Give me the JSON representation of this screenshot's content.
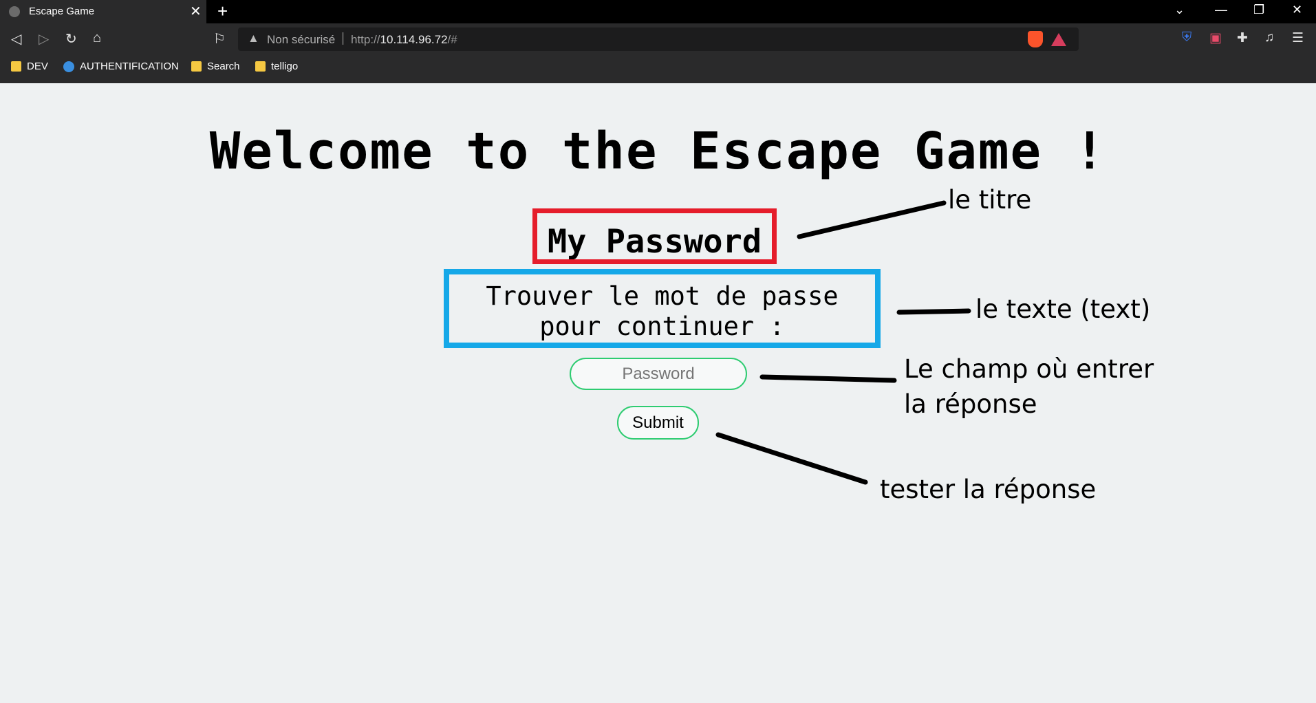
{
  "browser": {
    "tab_title": "Escape Game",
    "new_tab": "+",
    "url_warning": "Non sécurisé",
    "url_prefix": "http://",
    "url_host": "10.114.96.72",
    "url_path": "/#",
    "bookmarks": [
      "DEV",
      "AUTHENTIFICATION",
      "Search",
      "telligo"
    ]
  },
  "page": {
    "heading": "Welcome to the Escape Game !",
    "subheading": "My Password",
    "instruction": "Trouver le mot de passe pour continuer :",
    "password_placeholder": "Password",
    "submit_label": "Submit"
  },
  "annotations": {
    "title": "le titre",
    "text": "le texte (text)",
    "field_line1": "Le champ où entrer",
    "field_line2": "la réponse",
    "submit": "tester la réponse"
  },
  "colors": {
    "title_box": "#e51d2b",
    "text_box": "#15a8e8",
    "input_border": "#2ecc71"
  }
}
